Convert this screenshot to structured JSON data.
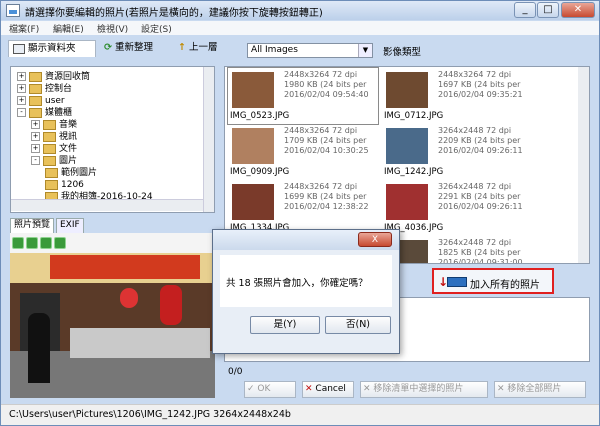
{
  "window": {
    "title": "請選擇你要編輯的照片(若照片是橫向的，建議你按下旋轉按鈕轉正)"
  },
  "menu": [
    "檔案(F)",
    "編輯(E)",
    "檢視(V)",
    "設定(S)"
  ],
  "toolbar": {
    "folders_tab": "顯示資料夾",
    "refresh": "重新整理",
    "up": "上一層",
    "filter_value": "All Images",
    "filter_label": "影像類型"
  },
  "tree": [
    {
      "label": "資源回收筒",
      "indent": 0,
      "expander": "+"
    },
    {
      "label": "控制台",
      "indent": 0,
      "expander": "+"
    },
    {
      "label": "user",
      "indent": 0,
      "expander": "+"
    },
    {
      "label": "媒體櫃",
      "indent": 0,
      "expander": "-"
    },
    {
      "label": "音樂",
      "indent": 1,
      "expander": "+"
    },
    {
      "label": "視訊",
      "indent": 1,
      "expander": "+"
    },
    {
      "label": "文件",
      "indent": 1,
      "expander": "+"
    },
    {
      "label": "圖片",
      "indent": 1,
      "expander": "-"
    },
    {
      "label": "範例圖片",
      "indent": 2,
      "expander": ""
    },
    {
      "label": "1206",
      "indent": 2,
      "expander": ""
    },
    {
      "label": "我的相簿-2016-10-24",
      "indent": 2,
      "expander": ""
    }
  ],
  "preview_tabs": [
    "照片預覽",
    "EXIF"
  ],
  "photos": [
    {
      "name": "IMG_0523.JPG",
      "dims": "2448x3264 72 dpi",
      "size": "1980 KB (24 bits per",
      "date": "2016/02/04 09:54:40",
      "selected": true
    },
    {
      "name": "IMG_0712.JPG",
      "dims": "2448x3264 72 dpi",
      "size": "1697 KB (24 bits per",
      "date": "2016/02/04 09:35:21",
      "selected": false
    },
    {
      "name": "IMG_0909.JPG",
      "dims": "2448x3264 72 dpi",
      "size": "1709 KB (24 bits per",
      "date": "2016/02/04 10:30:25",
      "selected": false
    },
    {
      "name": "IMG_1242.JPG",
      "dims": "3264x2448 72 dpi",
      "size": "2209 KB (24 bits per",
      "date": "2016/02/04 09:26:11",
      "selected": false
    },
    {
      "name": "IMG_1334.JPG",
      "dims": "2448x3264 72 dpi",
      "size": "1699 KB (24 bits per",
      "date": "2016/02/04 12:38:22",
      "selected": false
    },
    {
      "name": "IMG_4036.JPG",
      "dims": "3264x2448 72 dpi",
      "size": "2291 KB (24 bits per",
      "date": "2016/02/04 09:26:11",
      "selected": false
    },
    {
      "name": "",
      "dims": "",
      "size": "",
      "date": "",
      "selected": false
    },
    {
      "name": "",
      "dims": "3264x2448 72 dpi",
      "size": "1825 KB (24 bits per",
      "date": "2016/02/04 09:31:00",
      "selected": false
    }
  ],
  "add_all": "加入所有的照片",
  "count": "0/0",
  "buttons": {
    "ok": "OK",
    "cancel": "Cancel",
    "remove_selected": "移除清單中選擇的照片",
    "remove_all": "移除全部照片"
  },
  "status": "C:\\Users\\user\\Pictures\\1206\\IMG_1242.JPG  3264x2448x24b",
  "dialog": {
    "message": "共 18 張照片會加入，你確定嗎？",
    "yes": "是(Y)",
    "no": "否(N)",
    "close": "X"
  }
}
